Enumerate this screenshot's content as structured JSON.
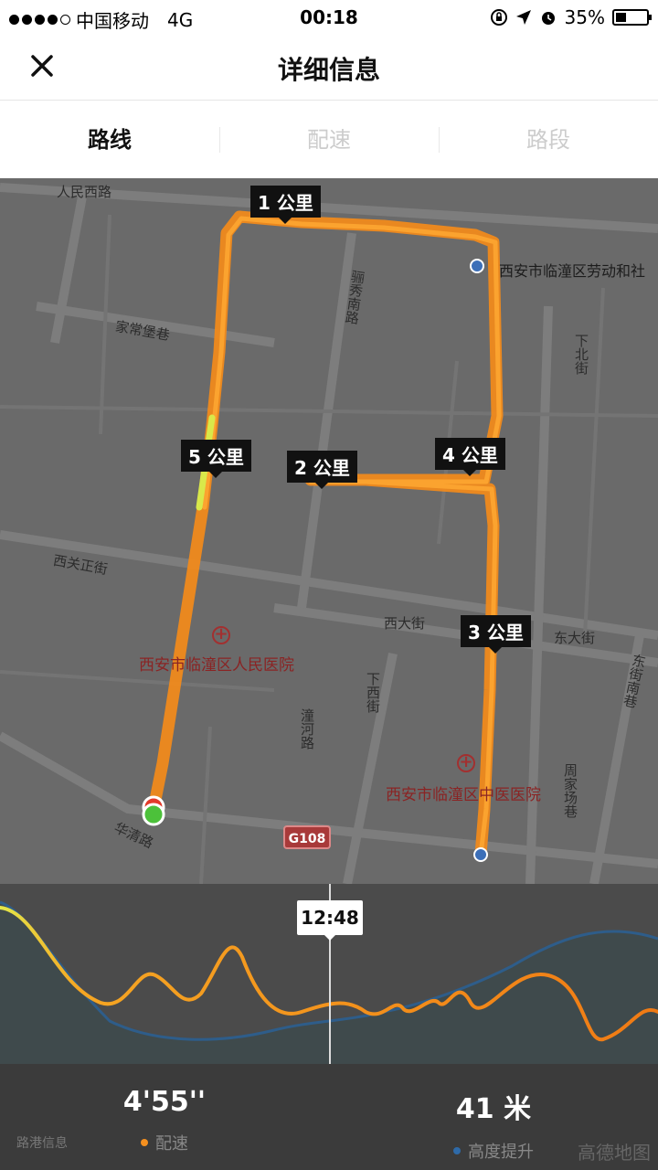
{
  "status_bar": {
    "carrier": "中国移动",
    "network": "4G",
    "time": "00:18",
    "battery": "35%",
    "battery_level": 0.35
  },
  "nav": {
    "title": "详细信息",
    "close_icon": "close-icon"
  },
  "tabs": [
    {
      "label": "路线",
      "active": true
    },
    {
      "label": "配速",
      "active": false
    },
    {
      "label": "路段",
      "active": false
    }
  ],
  "map": {
    "roads": {
      "renmin_west": "人民西路",
      "jiachang_bao": "家常堡巷",
      "jingxiu_south": "骊秀南路",
      "xiaguan_zheng": "西关正街",
      "xida": "西大街",
      "dongda": "东大街",
      "xiaxi": "下西街",
      "huaqing": "华清路",
      "huancheng": "潼河路",
      "xiabei": "下北街",
      "dongjie_south": "东街南巷",
      "zhoujia": "周家场巷",
      "highway": "G108"
    },
    "pois": {
      "hospital_people": "西安市临潼区人民医院",
      "hospital_tcm": "西安市临潼区中医医院",
      "community": "西安市临潼区劳动和社"
    },
    "km_markers": [
      "1 公里",
      "2 公里",
      "3 公里",
      "4 公里",
      "5 公里"
    ],
    "route_color": "#f5901f"
  },
  "chart": {
    "cursor_time": "12:48",
    "pace_color": "#f5901f",
    "elevation_color": "#2e5d8a"
  },
  "stats": {
    "pace": {
      "value": "4'55''",
      "label": "配速",
      "color": "#f5901f"
    },
    "elevation": {
      "value": "41 米",
      "label": "高度提升",
      "color": "#2e6aa8"
    }
  },
  "watermark": "高德地图",
  "watermark_left": "路港信息"
}
